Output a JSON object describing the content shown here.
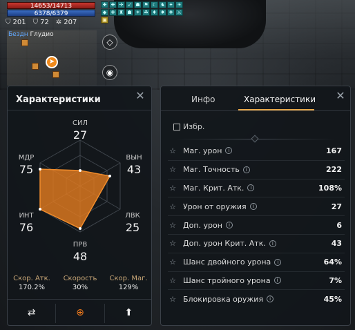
{
  "hud": {
    "hp": "14653/14713",
    "mp": "6378/6379",
    "stats": [
      {
        "icon": "shield-icon",
        "value": "201"
      },
      {
        "icon": "shield-icon",
        "value": "72"
      },
      {
        "icon": "gear-icon",
        "value": "207"
      }
    ],
    "map_label_left": "Бездн",
    "map_label_right": "Глудио"
  },
  "left_panel": {
    "title": "Характеристики",
    "radar": {
      "top": {
        "label": "СИЛ",
        "value": "27"
      },
      "right_top": {
        "label": "ВЫН",
        "value": "43"
      },
      "right_bottom": {
        "label": "ЛВК",
        "value": "25"
      },
      "bottom": {
        "label": "ПРВ",
        "value": "48"
      },
      "left_bottom": {
        "label": "ИНТ",
        "value": "76"
      },
      "left_top": {
        "label": "МДР",
        "value": "75"
      }
    },
    "speeds": [
      {
        "label": "Скор. Атк.",
        "value": "170.2%"
      },
      {
        "label": "Скорость",
        "value": "30%"
      },
      {
        "label": "Скор. Маг.",
        "value": "129%"
      }
    ]
  },
  "right_panel": {
    "tabs": [
      "Инфо",
      "Характеристики"
    ],
    "favorites_label": "Избр.",
    "stats": [
      {
        "name": "Маг. урон",
        "value": "167"
      },
      {
        "name": "Маг. Точность",
        "value": "222"
      },
      {
        "name": "Маг. Крит. Атк.",
        "value": "108%"
      },
      {
        "name": "Урон от оружия",
        "value": "27"
      },
      {
        "name": "Доп. урон",
        "value": "6"
      },
      {
        "name": "Доп. урон Крит. Атк.",
        "value": "43"
      },
      {
        "name": "Шанс двойного урона",
        "value": "64%"
      },
      {
        "name": "Шанс тройного урона",
        "value": "7%"
      },
      {
        "name": "Блокировка оружия",
        "value": "45%"
      }
    ]
  },
  "colors": {
    "accent": "#ef7a1c",
    "radar_fill": "#e07a20",
    "speed_label": "#c9a777",
    "tab_underline": "#e8a84a"
  }
}
